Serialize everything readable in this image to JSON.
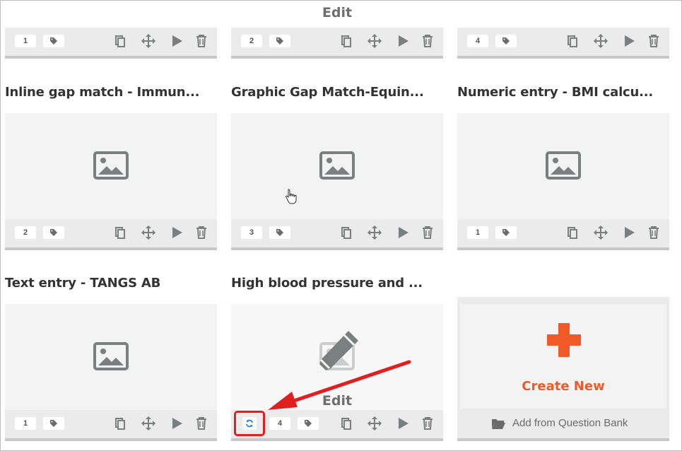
{
  "top_row": [
    {
      "count": "1",
      "edit_label": ""
    },
    {
      "count": "2",
      "edit_label": "Edit"
    },
    {
      "count": "4",
      "edit_label": ""
    }
  ],
  "items": [
    {
      "title": "Inline gap match - Immun...",
      "count": "2"
    },
    {
      "title": "Graphic Gap Match-Equin...",
      "count": "3"
    },
    {
      "title": "Numeric entry - BMI calcu...",
      "count": "1"
    },
    {
      "title": "Text entry - TANGS AB",
      "count": "1"
    },
    {
      "title": "High blood pressure and ...",
      "count": "4",
      "edit_label": "Edit"
    }
  ],
  "create": {
    "label": "Create New",
    "bank_label": "Add from Question Bank"
  },
  "colors": {
    "accent": "#f05a28",
    "highlight": "#e02020",
    "icon": "#7a7f7f",
    "refresh": "#1e88e5"
  },
  "icons": {
    "tag": "tag-icon",
    "copy": "copy-icon",
    "move": "move-icon",
    "play": "play-icon",
    "delete": "trash-icon",
    "image": "image-placeholder-icon",
    "edit": "pencil-icon",
    "refresh": "refresh-icon",
    "plus": "plus-icon",
    "folder": "folder-open-icon"
  }
}
